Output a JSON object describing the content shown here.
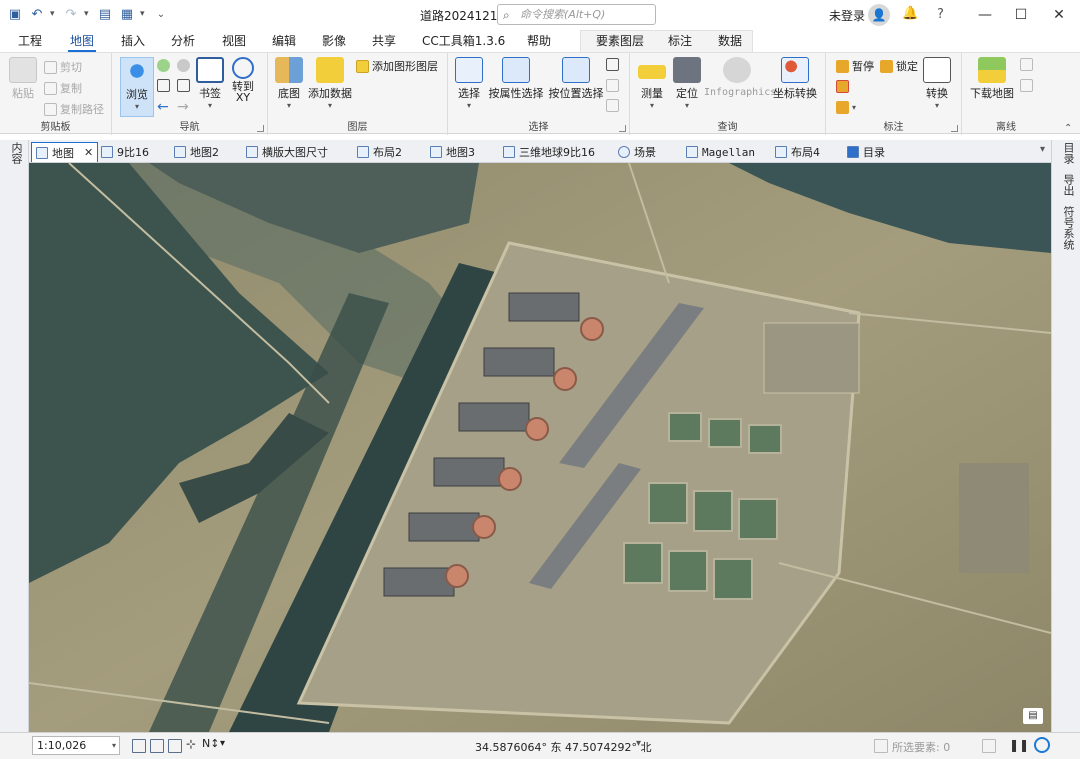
{
  "titlebar": {
    "document_title": "道路20241219",
    "search_placeholder": "命令搜索(Alt+Q)",
    "user_label": "未登录",
    "help_label": "?",
    "minimize": "—",
    "maximize": "☐",
    "close": "✕"
  },
  "tabs": [
    {
      "label": "工程"
    },
    {
      "label": "地图"
    },
    {
      "label": "插入"
    },
    {
      "label": "分析"
    },
    {
      "label": "视图"
    },
    {
      "label": "编辑"
    },
    {
      "label": "影像"
    },
    {
      "label": "共享"
    },
    {
      "label": "CC工具箱1.3.6"
    },
    {
      "label": "帮助"
    },
    {
      "label": "要素图层"
    },
    {
      "label": "标注"
    },
    {
      "label": "数据"
    }
  ],
  "active_tab": "地图",
  "ribbon": {
    "clipboard": {
      "label": "剪贴板",
      "paste": "粘贴",
      "cut": "剪切",
      "copy": "复制",
      "copy_path": "复制路径"
    },
    "navigate": {
      "label": "导航",
      "explore": "浏览",
      "bookmarks": "书签",
      "goto_xy": "转到\nXY"
    },
    "layer": {
      "label": "图层",
      "basemap": "底图",
      "add_data": "添加数据",
      "add_graphics": "添加图形图层"
    },
    "selection": {
      "label": "选择",
      "select": "选择",
      "by_attr": "按属性选择",
      "by_loc": "按位置选择"
    },
    "inquiry": {
      "label": "查询",
      "measure": "测量",
      "locate": "定位",
      "infographics": "Infographics",
      "convert_coord": "坐标转换"
    },
    "labeling": {
      "label": "标注",
      "pause": "暂停",
      "lock": "锁定",
      "convert": "转换"
    },
    "offline": {
      "label": "离线",
      "download_map": "下载地图"
    }
  },
  "view_tabs": [
    {
      "label": "地图",
      "active": true
    },
    {
      "label": "9比16"
    },
    {
      "label": "地图2"
    },
    {
      "label": "横版大图尺寸"
    },
    {
      "label": "布局2"
    },
    {
      "label": "地图3"
    },
    {
      "label": "三维地球9比16"
    },
    {
      "label": "场景"
    },
    {
      "label": "Magellan"
    },
    {
      "label": "布局4"
    },
    {
      "label": "目录"
    }
  ],
  "left_dock": {
    "label": "内容"
  },
  "right_dock": [
    {
      "label": "目录"
    },
    {
      "label": "导出"
    },
    {
      "label": "符号系统"
    }
  ],
  "status": {
    "scale": "1:10,026",
    "coordinates": "34.5876064° 东 47.5074292° 北",
    "selected_features": "所选要素: 0"
  },
  "colors": {
    "accent": "#1a6ed6",
    "ribbon_bg": "#f5f5f5"
  }
}
